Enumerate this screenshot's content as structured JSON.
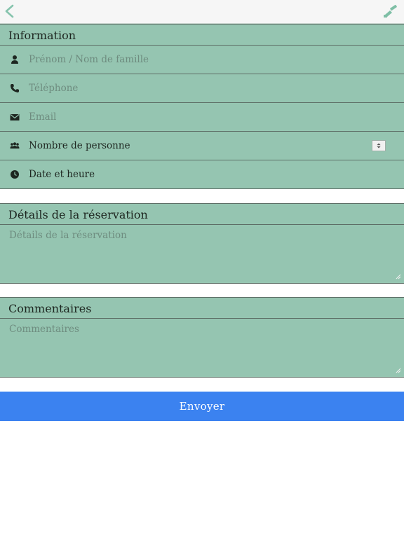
{
  "topbar": {
    "back_icon": "chevron-left-icon",
    "tool_icon": "paintbrush-icon"
  },
  "information": {
    "heading": "Information",
    "fields": [
      {
        "icon": "user-icon",
        "placeholder": "Prénom / Nom de famille"
      },
      {
        "icon": "phone-icon",
        "placeholder": "Téléphone"
      },
      {
        "icon": "envelope-icon",
        "placeholder": "Email"
      },
      {
        "icon": "group-icon",
        "label": "Nombre de personne"
      },
      {
        "icon": "clock-icon",
        "label": "Date et heure"
      }
    ]
  },
  "details": {
    "heading": "Détails de la réservation",
    "placeholder": "Détails de la réservation"
  },
  "comments": {
    "heading": "Commentaires",
    "placeholder": "Commentaires"
  },
  "submit": {
    "label": "Envoyer"
  },
  "colors": {
    "panel": "#95c5b1",
    "button": "#3b82f0",
    "accent": "#7fbfa6"
  }
}
